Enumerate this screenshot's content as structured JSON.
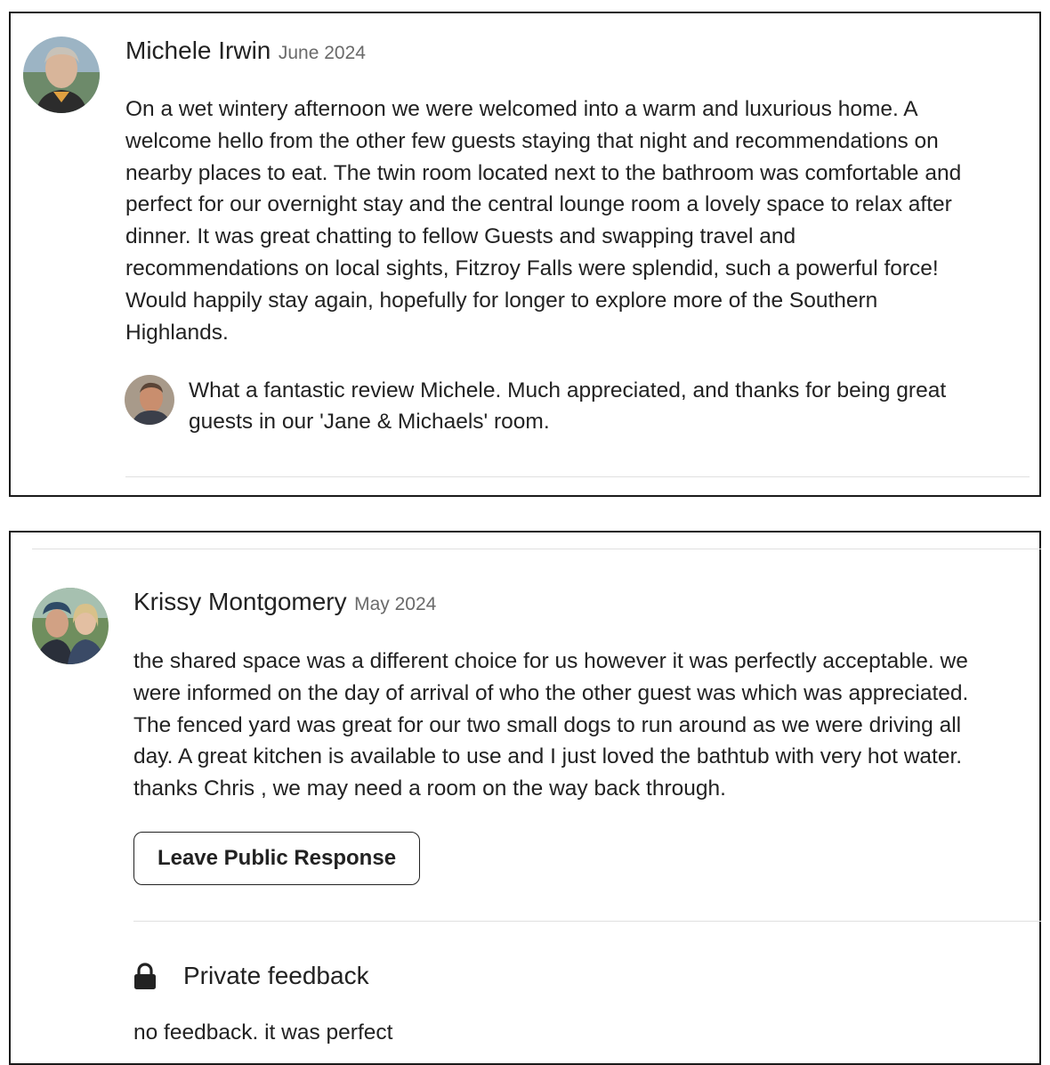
{
  "reviews": [
    {
      "reviewer_name": "Michele Irwin",
      "date": "June 2024",
      "text_lines": [
        "On a wet wintery afternoon we were welcomed into a warm and luxurious home. A",
        "welcome hello from the other few guests staying that night and recommendations on",
        "nearby places to eat. The twin room located next to the bathroom was comfortable and",
        "perfect for our overnight stay and the central lounge room a lovely space to relax after",
        "dinner. It was great chatting to fellow Guests and swapping travel and",
        "recommendations on local sights, Fitzroy Falls were splendid, such a powerful force!",
        "Would happily stay again, hopefully for longer to explore more of the Southern",
        "Highlands."
      ],
      "host_response_lines": [
        "What a fantastic review Michele. Much appreciated, and thanks for being great",
        "guests in our 'Jane & Michaels' room."
      ]
    },
    {
      "reviewer_name": "Krissy Montgomery",
      "date": "May 2024",
      "text_lines": [
        "the shared space was a different choice for us however it was perfectly acceptable. we",
        "were informed on the day of arrival of who the other guest was which was appreciated.",
        "The fenced yard was great for our two small dogs to run around as we were driving all",
        "day. A great kitchen is available to use and I just loved the bathtub with very hot water.",
        "thanks Chris , we may need a room on the way back through."
      ],
      "response_button_label": "Leave Public Response",
      "private_feedback": {
        "icon": "lock-icon",
        "title": "Private feedback",
        "text": "no feedback. it was perfect"
      }
    }
  ],
  "colors": {
    "text": "#222222",
    "muted": "#6a6a6a",
    "divider": "#e0e0e0",
    "border": "#1a1a1a"
  }
}
